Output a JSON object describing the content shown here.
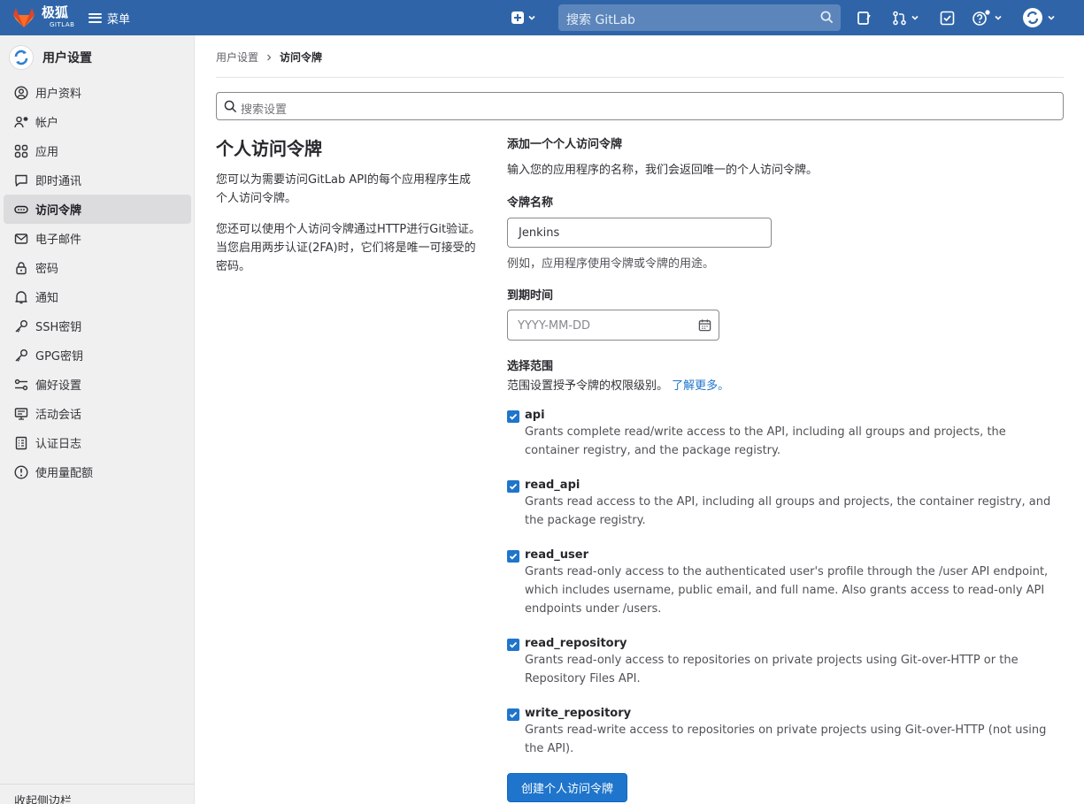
{
  "nav": {
    "brand": "极狐",
    "brand_sub": "GITLAB",
    "menu_label": "菜单",
    "search_placeholder": "搜索 GitLab"
  },
  "sidebar": {
    "title": "用户设置",
    "items": [
      {
        "label": "用户资料",
        "icon": "profile-icon"
      },
      {
        "label": "帐户",
        "icon": "account-icon"
      },
      {
        "label": "应用",
        "icon": "applications-icon"
      },
      {
        "label": "即时通讯",
        "icon": "chat-icon"
      },
      {
        "label": "访问令牌",
        "icon": "token-icon",
        "active": true
      },
      {
        "label": "电子邮件",
        "icon": "mail-icon"
      },
      {
        "label": "密码",
        "icon": "lock-icon"
      },
      {
        "label": "通知",
        "icon": "bell-icon"
      },
      {
        "label": "SSH密钥",
        "icon": "key-icon"
      },
      {
        "label": "GPG密钥",
        "icon": "key-icon"
      },
      {
        "label": "偏好设置",
        "icon": "preferences-icon"
      },
      {
        "label": "活动会话",
        "icon": "monitor-icon"
      },
      {
        "label": "认证日志",
        "icon": "log-icon"
      },
      {
        "label": "使用量配额",
        "icon": "quota-icon"
      }
    ],
    "collapse_label": "收起侧边栏"
  },
  "breadcrumb": {
    "parent": "用户设置",
    "current": "访问令牌"
  },
  "search_settings": {
    "placeholder": "搜索设置"
  },
  "intro": {
    "title": "个人访问令牌",
    "p1": "您可以为需要访问GitLab API的每个应用程序生成个人访问令牌。",
    "p2": "您还可以使用个人访问令牌通过HTTP进行Git验证。当您启用两步认证(2FA)时，它们将是唯一可接受的密码。"
  },
  "form": {
    "heading": "添加一个个人访问令牌",
    "subheading": "输入您的应用程序的名称，我们会返回唯一的个人访问令牌。",
    "name_label": "令牌名称",
    "name_value": "Jenkins",
    "name_help": "例如，应用程序使用令牌或令牌的用途。",
    "expiry_label": "到期时间",
    "expiry_placeholder": "YYYY-MM-DD",
    "scopes_label": "选择范围",
    "scopes_help": "范围设置授予令牌的权限级别。",
    "learn_more": "了解更多。",
    "scopes": [
      {
        "name": "api",
        "checked": true,
        "desc": "Grants complete read/write access to the API, including all groups and projects, the container registry, and the package registry."
      },
      {
        "name": "read_api",
        "checked": true,
        "desc": "Grants read access to the API, including all groups and projects, the container registry, and the package registry."
      },
      {
        "name": "read_user",
        "checked": true,
        "desc": "Grants read-only access to the authenticated user's profile through the /user API endpoint, which includes username, public email, and full name. Also grants access to read-only API endpoints under /users."
      },
      {
        "name": "read_repository",
        "checked": true,
        "desc": "Grants read-only access to repositories on private projects using Git-over-HTTP or the Repository Files API."
      },
      {
        "name": "write_repository",
        "checked": true,
        "desc": "Grants read-write access to repositories on private projects using Git-over-HTTP (not using the API)."
      }
    ],
    "submit_label": "创建个人访问令牌"
  },
  "colors": {
    "navbar": "#2f65a8",
    "primary": "#1f75cb",
    "sidebar_bg": "#f0f0f0"
  }
}
